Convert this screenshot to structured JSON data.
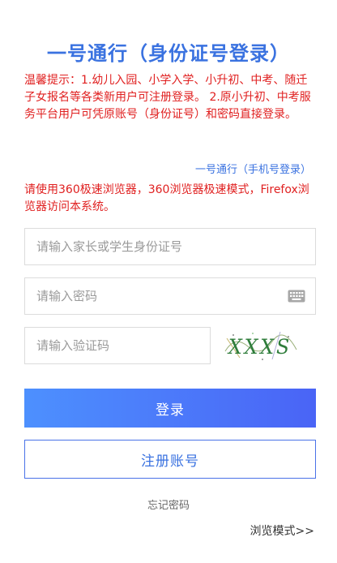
{
  "header": {
    "title": "一号通行（身份证号登录）"
  },
  "notice": {
    "text": "温馨提示：1.幼儿入园、小学入学、小升初、中考、随迁子女报名等各类新用户可注册登录。 2.原小升初、中考服务平台用户可凭原账号（身份证号）和密码直接登录。"
  },
  "links": {
    "phone_login": "一号通行（手机号登录）",
    "forgot_password": "忘记密码",
    "browse_mode": "浏览模式>>"
  },
  "browser_tip": {
    "text": "请使用360极速浏览器，360浏览器极速模式，Firefox浏览器访问本系统。"
  },
  "form": {
    "id_placeholder": "请输入家长或学生身份证号",
    "password_placeholder": "请输入密码",
    "captcha_placeholder": "请输入验证码",
    "captcha_text": "XXXS",
    "login_label": "登录",
    "register_label": "注册账号"
  },
  "colors": {
    "accent": "#3a72e0",
    "warning": "#e02020",
    "button_gradient_start": "#4d90fe",
    "button_gradient_end": "#4a64f6"
  },
  "icons": {
    "password_field": "keyboard-icon"
  }
}
